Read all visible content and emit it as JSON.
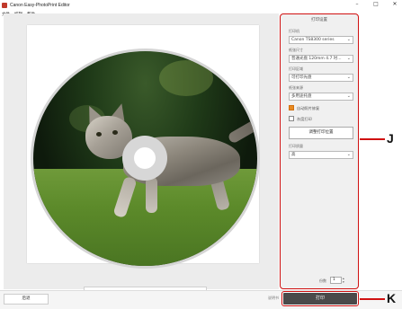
{
  "window": {
    "title": "Canon Easy-PhotoPrint Editor",
    "controls": [
      "–",
      "□",
      "✕"
    ]
  },
  "menu": [
    "文件",
    "编辑",
    "帮助"
  ],
  "navigator": {
    "prev": "‹",
    "page": "1/1",
    "next": "›",
    "zoom_out": "−",
    "zoom_in": "+"
  },
  "settings_panel": {
    "title": "打印设置",
    "printer_label": "打印机",
    "printer_value": "Canon TS8300 series",
    "paper_size_label": "纸张尺寸",
    "paper_size_value": "普通光盘 120mm 4.7 吋...",
    "print_area_label": "打印区域",
    "print_area_value": "可打印光盘",
    "paper_source_label": "纸张来源",
    "paper_source_value": "多用途托盘",
    "auto_correct_label": "自动照片修复",
    "auto_correct_checked": true,
    "grayscale_label": "灰度打印",
    "grayscale_checked": false,
    "adjust_position_label": "调整打印位置",
    "print_quality_label": "打印质量",
    "print_quality_value": "高",
    "copies_label": "份数",
    "copies_value": "1"
  },
  "bottom": {
    "back_label": "后退",
    "help_text": "说明书",
    "print_label": "打印"
  },
  "callouts": {
    "panel_letter": "J",
    "print_letter": "K",
    "color": "#d01010"
  }
}
